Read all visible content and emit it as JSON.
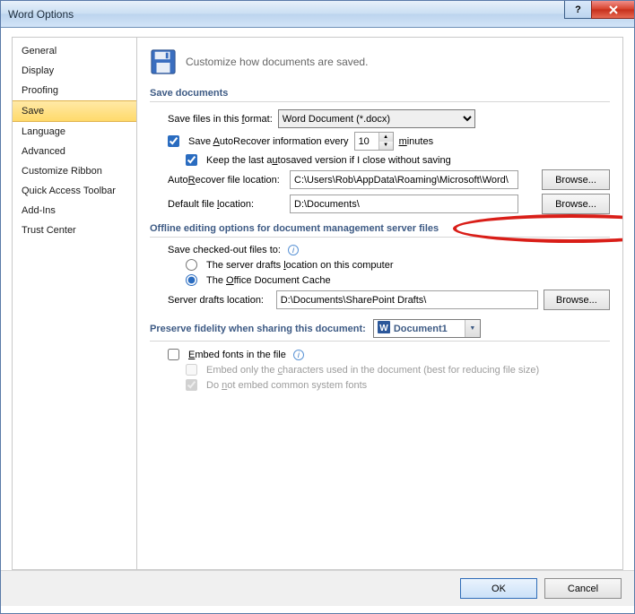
{
  "window": {
    "title": "Word Options"
  },
  "sidebar": {
    "items": [
      {
        "label": "General"
      },
      {
        "label": "Display"
      },
      {
        "label": "Proofing"
      },
      {
        "label": "Save"
      },
      {
        "label": "Language"
      },
      {
        "label": "Advanced"
      },
      {
        "label": "Customize Ribbon"
      },
      {
        "label": "Quick Access Toolbar"
      },
      {
        "label": "Add-Ins"
      },
      {
        "label": "Trust Center"
      }
    ],
    "selected_index": 3
  },
  "header": {
    "tagline": "Customize how documents are saved."
  },
  "groups": {
    "save_docs": "Save documents",
    "offline": "Offline editing options for document management server files",
    "fidelity": "Preserve fidelity when sharing this document:"
  },
  "save": {
    "format_label": "Save files in this format:",
    "format_value": "Word Document (*.docx)",
    "autorecover_label": "Save AutoRecover information every",
    "autorecover_minutes": "10",
    "minutes_label": "minutes",
    "keep_last_label": "Keep the last autosaved version if I close without saving",
    "ar_loc_label": "AutoRecover file location:",
    "ar_loc_value": "C:\\Users\\Rob\\AppData\\Roaming\\Microsoft\\Word\\",
    "def_loc_label": "Default file location:",
    "def_loc_value": "D:\\Documents\\",
    "browse": "Browse..."
  },
  "offline": {
    "save_checked_label": "Save checked-out files to:",
    "opt_server": "The server drafts location on this computer",
    "opt_cache": "The Office Document Cache",
    "drafts_label": "Server drafts location:",
    "drafts_value": "D:\\Documents\\SharePoint Drafts\\"
  },
  "fidelity": {
    "doc_name": "Document1",
    "embed_fonts": "Embed fonts in the file",
    "embed_chars": "Embed only the characters used in the document (best for reducing file size)",
    "embed_common": "Do not embed common system fonts"
  },
  "footer": {
    "ok": "OK",
    "cancel": "Cancel"
  }
}
